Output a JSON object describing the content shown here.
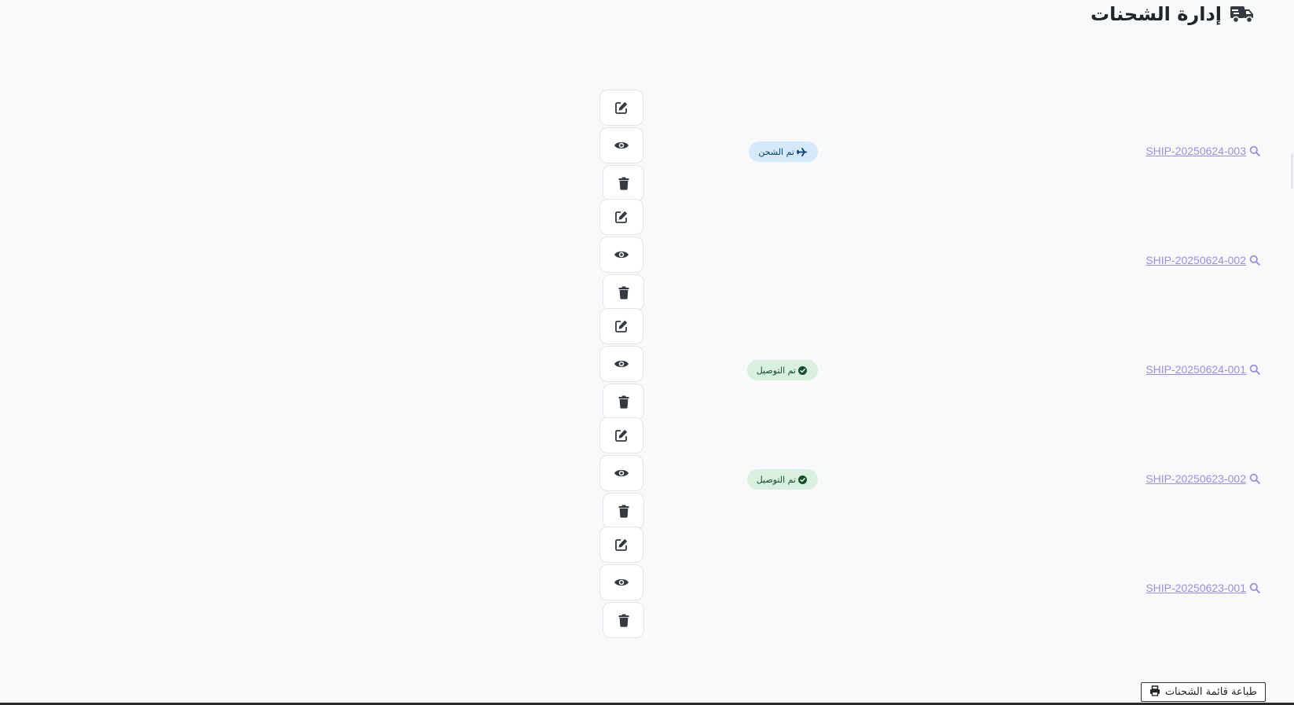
{
  "page": {
    "title": "إدارة الشحنات",
    "icon": "truck-icon"
  },
  "shipments": [
    {
      "id": "SHIP-20250624-003",
      "status": "تم الشحن",
      "status_type": "shipped",
      "status_icon": "plane-icon"
    },
    {
      "id": "SHIP-20250624-002",
      "status": "",
      "status_type": "",
      "status_icon": ""
    },
    {
      "id": "SHIP-20250624-001",
      "status": "تم التوصيل",
      "status_type": "delivered",
      "status_icon": "check-circle-icon"
    },
    {
      "id": "SHIP-20250623-002",
      "status": "تم التوصيل",
      "status_type": "delivered",
      "status_icon": "check-circle-icon"
    },
    {
      "id": "SHIP-20250623-001",
      "status": "",
      "status_type": "",
      "status_icon": ""
    }
  ],
  "actions": {
    "edit_icon": "edit-icon",
    "view_icon": "eye-icon",
    "delete_icon": "trash-icon"
  },
  "print": {
    "label": "طباعة قائمة الشحنات",
    "icon": "printer-icon"
  },
  "colors": {
    "link": "#9b8fe0",
    "shipped_badge_bg": "#d6e9fb",
    "delivered_badge_bg": "#d9efdf",
    "icon_dark": "#343a40"
  }
}
